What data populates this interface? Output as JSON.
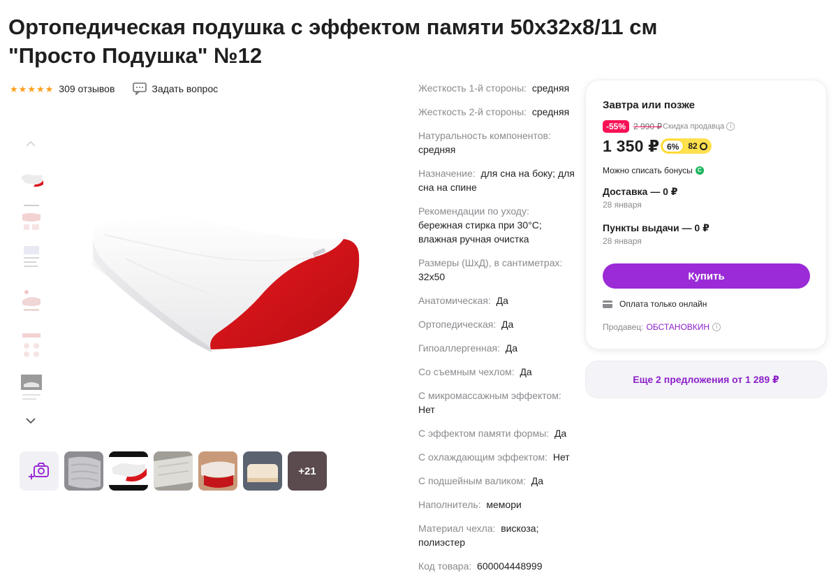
{
  "product": {
    "title_line1": "Ортопедическая подушка с эффектом памяти 50х32х8/11 см",
    "title_line2": "\"Просто Подушка\" №12",
    "rating_stars": 5,
    "reviews": "309 отзывов",
    "ask_question": "Задать вопрос"
  },
  "gallery": {
    "extra_count": "+21",
    "icons": [
      "chevron-up-icon",
      "chevron-down-icon",
      "add-photo-camera-icon"
    ]
  },
  "specs": [
    {
      "key": "Жесткость 1-й стороны:",
      "value": "средняя"
    },
    {
      "key": "Жесткость 2-й стороны:",
      "value": "средняя"
    },
    {
      "key": "Натуральность компонентов:",
      "value": "средняя"
    },
    {
      "key": "Назначение:",
      "value": "для сна на боку; для сна на спине"
    },
    {
      "key": "Рекомендации по уходу:",
      "value": "бережная стирка при 30°С; влажная ручная очистка"
    },
    {
      "key": "Размеры (ШхД), в сантиметрах:",
      "value": "32х50"
    },
    {
      "key": "Анатомическая:",
      "value": "Да"
    },
    {
      "key": "Ортопедическая:",
      "value": "Да"
    },
    {
      "key": "Гипоаллергенная:",
      "value": "Да"
    },
    {
      "key": "Со съемным чехлом:",
      "value": "Да"
    },
    {
      "key": "С микромассажным эффектом:",
      "value": "Нет"
    },
    {
      "key": "С эффектом памяти формы:",
      "value": "Да"
    },
    {
      "key": "С охлаждающим эффектом:",
      "value": "Нет"
    },
    {
      "key": "С подшейным валиком:",
      "value": "Да"
    },
    {
      "key": "Наполнитель:",
      "value": "мемори"
    },
    {
      "key": "Материал чехла:",
      "value": "вискоза; полиэстер"
    },
    {
      "key": "Код товара:",
      "value": "600004448999"
    }
  ],
  "buy_card": {
    "delivery_heading": "Завтра или позже",
    "discount": "-55%",
    "old_price": "2 990 ₽",
    "seller_discount": "Скидка продавца",
    "price": "1 350 ₽",
    "bonus_percent": "6%",
    "bonus_points": "82",
    "can_pay_bonuses": "Можно списать бонусы",
    "delivery": "Доставка — 0 ₽",
    "delivery_date": "28 января",
    "pickup": "Пункты выдачи — 0 ₽",
    "pickup_date": "28 января",
    "buy_button": "Купить",
    "payment": "Оплата только онлайн",
    "seller_label": "Продавец:",
    "seller_name": "ОБСТАНОВКИН"
  },
  "offers": "Еще 2 предложения от 1 289 ₽",
  "colors": {
    "accent": "#9b2bd6",
    "discount": "#f91155",
    "star": "#ff9f1c",
    "bonus": "#ffe04d",
    "pillow_red": "#d8151b"
  }
}
